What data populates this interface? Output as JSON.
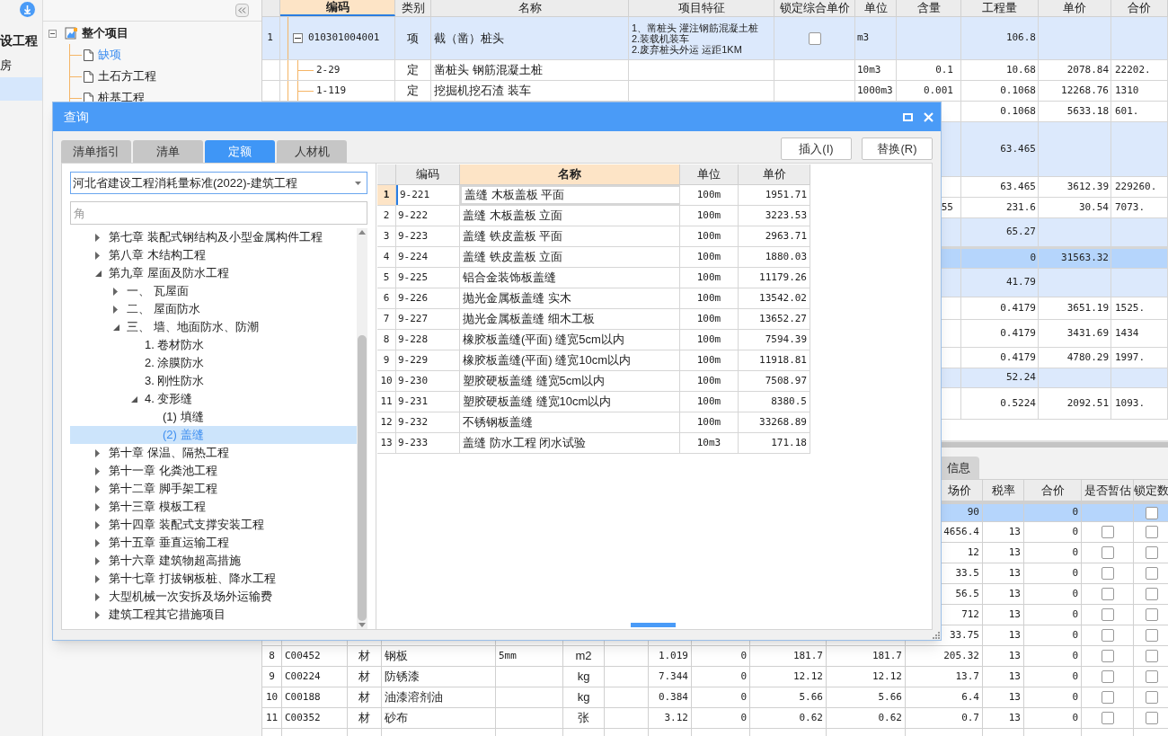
{
  "sidebar": {
    "items": [
      {
        "kind": "heading",
        "label": "设工程",
        "selected": false
      },
      {
        "kind": "item",
        "label": "房",
        "selected": false
      },
      {
        "kind": "item",
        "selected": true
      }
    ]
  },
  "project_tree": {
    "label": "整个项目",
    "expanded": true,
    "selected": false,
    "children": [
      {
        "label": "缺项",
        "selected": true
      },
      {
        "label": "土石方工程",
        "selected": false
      },
      {
        "label": "桩基工程",
        "selected": false
      }
    ]
  },
  "main_table": {
    "columns": [
      {
        "label": "编码",
        "selected": true
      },
      {
        "label": "类别",
        "selected": false
      },
      {
        "label": "名称",
        "selected": false
      },
      {
        "label": "项目特征",
        "selected": false
      },
      {
        "label": "锁定综合单价",
        "selected": false
      },
      {
        "label": "单位",
        "selected": false
      },
      {
        "label": "含量",
        "selected": false
      },
      {
        "label": "工程量",
        "selected": false
      },
      {
        "label": "单价",
        "selected": false
      },
      {
        "label": "合价",
        "selected": false
      }
    ],
    "rows": [
      {
        "kind": "bill",
        "selected": false,
        "expanded": true,
        "cells": {
          "num": "1",
          "code": "010301004001",
          "type": "项",
          "name": "截（凿）桩头",
          "feature": [
            "1、凿桩头 灌注钢筋混凝土桩",
            "2.装载机装车",
            "2.废弃桩头外运 运距1KM"
          ],
          "locked": false,
          "unit": "m3",
          "quantity": "106.8"
        }
      },
      {
        "kind": "item",
        "selected": false,
        "cells": {
          "code": "2-29",
          "type": "定",
          "name": "凿桩头 钢筋混凝土桩",
          "unit": "10m3",
          "content": "0.1",
          "quantity": "10.68",
          "price": "2078.84",
          "total": "22202."
        }
      },
      {
        "kind": "item",
        "selected": false,
        "cells": {
          "code": "1-119",
          "type": "定",
          "name": "挖掘机挖石渣 装车",
          "unit": "1000m3",
          "content": "0.001",
          "quantity": "0.1068",
          "price": "12268.76",
          "total": "1310"
        }
      },
      {
        "kind": "item",
        "selected": false,
        "cells": {
          "quantity": "0.1068",
          "price": "5633.18",
          "total": "601."
        }
      },
      {
        "kind": "bill",
        "selected": false,
        "cells": {
          "quantity": "63.465"
        }
      },
      {
        "kind": "item",
        "selected": false,
        "cells": {
          "quantity": "63.465",
          "price": "3612.39",
          "total": "229260."
        }
      },
      {
        "kind": "item",
        "selected": false,
        "cells": {
          "content": "55",
          "quantity": "231.6",
          "price": "30.54",
          "total": "7073."
        }
      },
      {
        "kind": "bill",
        "selected": false,
        "cells": {
          "quantity": "65.27"
        }
      },
      {
        "kind": "item",
        "selected": true,
        "cells": {
          "quantity": "0",
          "price": "31563.32"
        }
      },
      {
        "kind": "bill",
        "selected": false,
        "cells": {
          "quantity": "41.79"
        }
      },
      {
        "kind": "item",
        "selected": false,
        "cells": {
          "quantity": "0.4179",
          "price": "3651.19",
          "total": "1525."
        }
      },
      {
        "kind": "item",
        "selected": false,
        "cells": {
          "quantity": "0.4179",
          "price": "3431.69",
          "total": "1434"
        }
      },
      {
        "kind": "item",
        "selected": false,
        "cells": {
          "quantity": "0.4179",
          "price": "4780.29",
          "total": "1997."
        }
      },
      {
        "kind": "bill",
        "selected": false,
        "cells": {
          "quantity": "52.24"
        }
      },
      {
        "kind": "item",
        "selected": false,
        "cells": {
          "quantity": "0.5224",
          "price": "2092.51",
          "total": "1093."
        }
      }
    ]
  },
  "bottom_panel": {
    "tabs": [
      {
        "label": "信息",
        "selected": false
      }
    ],
    "columns": [
      "场价",
      "税率",
      "合价",
      "是否暂估",
      "锁定数"
    ],
    "rows": [
      {
        "selected": true,
        "cells": {
          "price": "90",
          "total": "0",
          "lock": false
        }
      },
      {
        "selected": false,
        "cells": {
          "price": "4656.4",
          "tax_rate": "13",
          "total": "0",
          "estimate": false,
          "lock": false
        }
      },
      {
        "selected": false,
        "cells": {
          "price": "12",
          "tax_rate": "13",
          "total": "0",
          "estimate": false,
          "lock": false
        }
      },
      {
        "selected": false,
        "cells": {
          "price": "33.5",
          "tax_rate": "13",
          "total": "0",
          "estimate": false,
          "lock": false
        }
      },
      {
        "selected": false,
        "cells": {
          "price": "56.5",
          "tax_rate": "13",
          "total": "0",
          "estimate": false,
          "lock": false
        }
      },
      {
        "selected": false,
        "cells": {
          "price": "712",
          "tax_rate": "13",
          "total": "0",
          "estimate": false,
          "lock": false
        }
      },
      {
        "selected": false,
        "cells": {
          "price": "33.75",
          "tax_rate": "13",
          "total": "0",
          "estimate": false,
          "lock": false
        }
      },
      {
        "selected": false,
        "cells": {
          "column_1": "8",
          "column_2": "C00452",
          "column_3": "材",
          "column_4": "钢板",
          "column_5": "5mm",
          "column_6": "m2",
          "column_8": "1.019",
          "column_9": "0",
          "column_10": "181.7",
          "column_11": "181.7",
          "price": "205.32",
          "tax_rate": "13",
          "total": "0",
          "estimate": false,
          "lock": false
        }
      },
      {
        "selected": false,
        "cells": {
          "column_1": "9",
          "column_2": "C00224",
          "column_3": "材",
          "column_4": "防锈漆",
          "column_6": "kg",
          "column_8": "7.344",
          "column_9": "0",
          "column_10": "12.12",
          "column_11": "12.12",
          "price": "13.7",
          "tax_rate": "13",
          "total": "0",
          "estimate": false,
          "lock": false
        }
      },
      {
        "selected": false,
        "cells": {
          "column_1": "10",
          "column_2": "C00188",
          "column_3": "材",
          "column_4": "油漆溶剂油",
          "column_6": "kg",
          "column_8": "0.384",
          "column_9": "0",
          "column_10": "5.66",
          "column_11": "5.66",
          "price": "6.4",
          "tax_rate": "13",
          "total": "0",
          "estimate": false,
          "lock": false
        }
      },
      {
        "selected": false,
        "cells": {
          "column_1": "11",
          "column_2": "C00352",
          "column_3": "材",
          "column_4": "砂布",
          "column_6": "张",
          "column_8": "3.12",
          "column_9": "0",
          "column_10": "0.62",
          "column_11": "0.62",
          "price": "0.7",
          "tax_rate": "13",
          "total": "0",
          "estimate": false,
          "lock": false
        }
      },
      {
        "selected": false,
        "cells": {}
      }
    ]
  },
  "dialog": {
    "title": "查询",
    "tabs": [
      {
        "label": "清单指引",
        "selected": false
      },
      {
        "label": "清单",
        "selected": false
      },
      {
        "label": "定额",
        "selected": true
      },
      {
        "label": "人材机",
        "selected": false
      }
    ],
    "buttons": [
      "插入(I)",
      "替换(R)"
    ],
    "library": "河北省建设工程消耗量标准(2022)-建筑工程",
    "search": {
      "placeholder": "角"
    },
    "tree": [
      {
        "label": "第七章 装配式钢结构及小型金属构件工程",
        "expanded": false,
        "selected": false
      },
      {
        "label": "第八章 木结构工程",
        "expanded": false,
        "selected": false
      },
      {
        "label": "第九章 屋面及防水工程",
        "expanded": true,
        "selected": false,
        "children": [
          {
            "label": "一、 瓦屋面",
            "expanded": false,
            "selected": false
          },
          {
            "label": "二、 屋面防水",
            "expanded": false,
            "selected": false
          },
          {
            "label": "三、 墙、地面防水、防潮",
            "expanded": true,
            "selected": false,
            "children": [
              {
                "label": "1. 卷材防水",
                "selected": false
              },
              {
                "label": "2. 涂膜防水",
                "selected": false
              },
              {
                "label": "3. 刚性防水",
                "selected": false
              },
              {
                "label": "4. 变形缝",
                "expanded": true,
                "selected": false,
                "children": [
                  {
                    "label": "(1) 填缝",
                    "selected": false
                  },
                  {
                    "label": "(2) 盖缝",
                    "selected": true
                  }
                ]
              }
            ]
          }
        ]
      },
      {
        "label": "第十章 保温、隔热工程",
        "expanded": false,
        "selected": false
      },
      {
        "label": "第十一章 化粪池工程",
        "expanded": false,
        "selected": false
      },
      {
        "label": "第十二章 脚手架工程",
        "expanded": false,
        "selected": false
      },
      {
        "label": "第十三章 模板工程",
        "expanded": false,
        "selected": false
      },
      {
        "label": "第十四章 装配式支撑安装工程",
        "expanded": false,
        "selected": false
      },
      {
        "label": "第十五章 垂直运输工程",
        "expanded": false,
        "selected": false
      },
      {
        "label": "第十六章 建筑物超高措施",
        "expanded": false,
        "selected": false
      },
      {
        "label": "第十七章 打拔钢板桩、降水工程",
        "expanded": false,
        "selected": false
      },
      {
        "label": "大型机械一次安拆及场外运输费",
        "expanded": false,
        "selected": false
      },
      {
        "label": "建筑工程其它措施项目",
        "expanded": false,
        "selected": false
      }
    ],
    "grid": {
      "columns": [
        {
          "label": "编码",
          "selected": false
        },
        {
          "label": "名称",
          "selected": true
        },
        {
          "label": "单位",
          "selected": false
        },
        {
          "label": "单价",
          "selected": false
        }
      ],
      "rows": [
        {
          "num": "1",
          "code": "9-221",
          "name": "盖缝 木板盖板 平面",
          "unit": "100m",
          "price": "1951.71",
          "selected": true
        },
        {
          "num": "2",
          "code": "9-222",
          "name": "盖缝 木板盖板 立面",
          "unit": "100m",
          "price": "3223.53",
          "selected": false
        },
        {
          "num": "3",
          "code": "9-223",
          "name": "盖缝 铁皮盖板 平面",
          "unit": "100m",
          "price": "2963.71",
          "selected": false
        },
        {
          "num": "4",
          "code": "9-224",
          "name": "盖缝 铁皮盖板 立面",
          "unit": "100m",
          "price": "1880.03",
          "selected": false
        },
        {
          "num": "5",
          "code": "9-225",
          "name": "铝合金装饰板盖缝",
          "unit": "100m",
          "price": "11179.26",
          "selected": false
        },
        {
          "num": "6",
          "code": "9-226",
          "name": "抛光金属板盖缝 实木",
          "unit": "100m",
          "price": "13542.02",
          "selected": false
        },
        {
          "num": "7",
          "code": "9-227",
          "name": "抛光金属板盖缝 细木工板",
          "unit": "100m",
          "price": "13652.27",
          "selected": false
        },
        {
          "num": "8",
          "code": "9-228",
          "name": "橡胶板盖缝(平面) 缝宽5cm以内",
          "unit": "100m",
          "price": "7594.39",
          "selected": false
        },
        {
          "num": "9",
          "code": "9-229",
          "name": "橡胶板盖缝(平面) 缝宽10cm以内",
          "unit": "100m",
          "price": "11918.81",
          "selected": false
        },
        {
          "num": "10",
          "code": "9-230",
          "name": "塑胶硬板盖缝 缝宽5cm以内",
          "unit": "100m",
          "price": "7508.97",
          "selected": false
        },
        {
          "num": "11",
          "code": "9-231",
          "name": "塑胶硬板盖缝 缝宽10cm以内",
          "unit": "100m",
          "price": "8380.5",
          "selected": false
        },
        {
          "num": "12",
          "code": "9-232",
          "name": "不锈钢板盖缝",
          "unit": "100m",
          "price": "33268.89",
          "selected": false
        },
        {
          "num": "13",
          "code": "9-233",
          "name": "盖缝 防水工程 闭水试验",
          "unit": "10m3",
          "price": "171.18",
          "selected": false
        }
      ]
    }
  }
}
